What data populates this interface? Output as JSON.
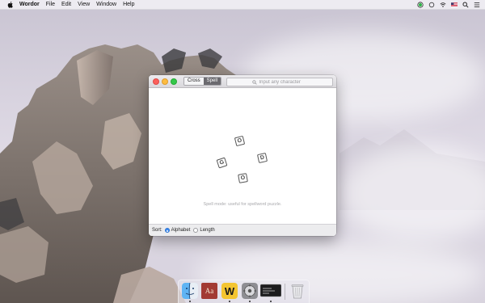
{
  "menubar": {
    "app_name": "Wordor",
    "items": [
      "File",
      "Edit",
      "View",
      "Window",
      "Help"
    ]
  },
  "window": {
    "tabs": [
      {
        "label": "Cross",
        "active": false
      },
      {
        "label": "Spell",
        "active": true
      }
    ],
    "search": {
      "placeholder": "Input any character"
    },
    "letters": [
      "O",
      "D",
      "O",
      "G"
    ],
    "hint": "Spell mode: useful for spellword puzzle.",
    "footer": {
      "sort_label": "Sort:",
      "options": [
        {
          "label": "Alphabet",
          "selected": true
        },
        {
          "label": "Length",
          "selected": false
        }
      ]
    }
  },
  "dock": {
    "apps": [
      "finder-icon",
      "dictionary-icon",
      "wordor-icon",
      "system-preferences-icon",
      "console-icon",
      "trash-icon"
    ],
    "dictionary_glyph": "Aa",
    "wordor_glyph": "W"
  },
  "colors": {
    "traffic_close": "#fc605c",
    "traffic_min": "#fdbc40",
    "traffic_max": "#34c84a",
    "radio_selected": "#3d8cf0",
    "wordor_brand": "#f4c531"
  }
}
